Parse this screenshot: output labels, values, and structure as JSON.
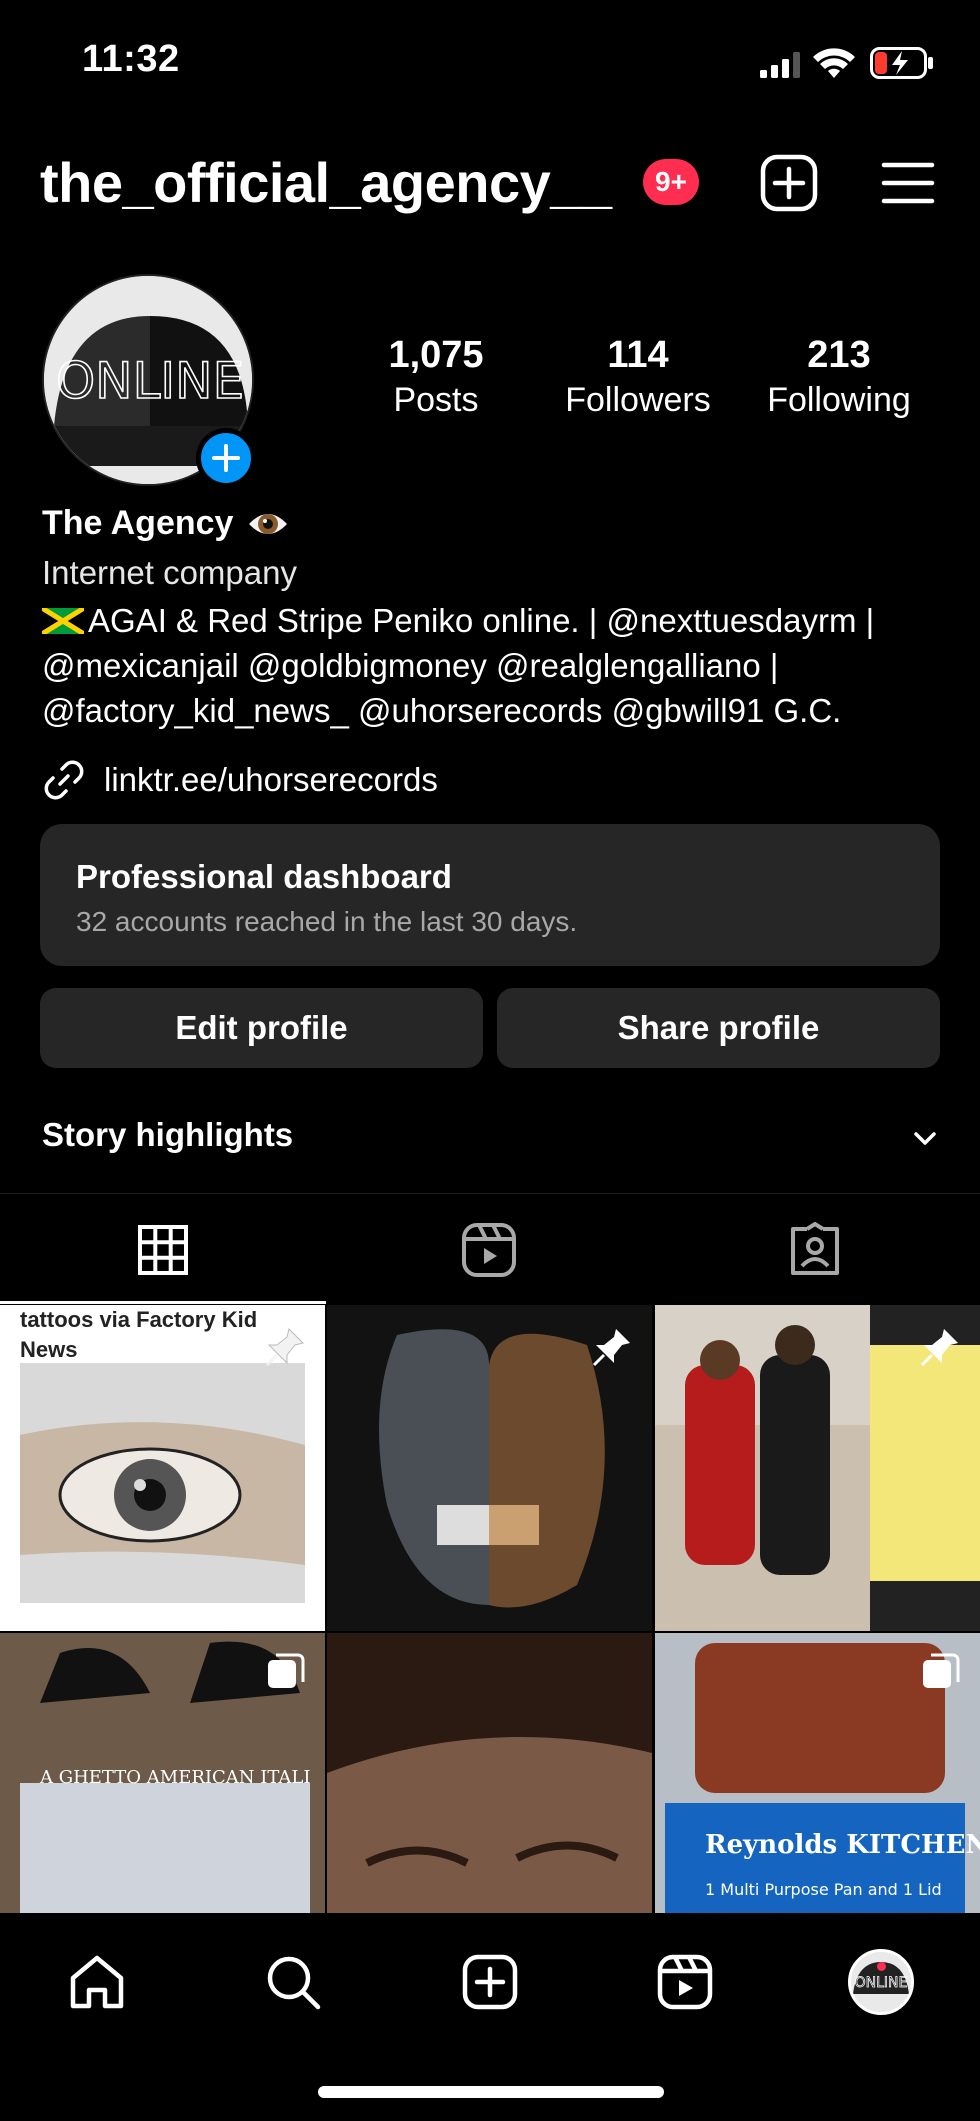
{
  "status_bar": {
    "time": "11:32",
    "icons": [
      "signal-icon",
      "wifi-icon",
      "battery-charging-icon"
    ]
  },
  "header": {
    "username": "the_official_agency__",
    "notifications": "9+",
    "icons": [
      "create-post-icon",
      "menu-icon"
    ]
  },
  "profile": {
    "avatar_text": "ONLINE",
    "stats": [
      {
        "value": "1,075",
        "label": "Posts"
      },
      {
        "value": "114",
        "label": "Followers"
      },
      {
        "value": "213",
        "label": "Following"
      }
    ],
    "display_name": "The Agency",
    "category": "Internet company",
    "bio_lines": [
      "AGAI & Red Stripe Peniko online. | @nexttuesdayrm |",
      "@mexicanjail @goldbigmoney @realglengalliano |",
      "@factory_kid_news_ @uhorserecords @gbwill91 G.C."
    ],
    "link": "linktr.ee/uhorserecords"
  },
  "dashboard": {
    "title": "Professional dashboard",
    "subtitle": "32 accounts reached in the last 30 days."
  },
  "buttons": {
    "edit": "Edit profile",
    "share": "Share profile"
  },
  "highlights": {
    "label": "Story highlights"
  },
  "tabs": [
    "grid-icon",
    "reels-icon",
    "tagged-icon"
  ],
  "grid": {
    "tile1_caption": "tattoos via Factory Kid News",
    "tile4_text": "A GHETTO AMERICAN ITALI",
    "tile6_text": "Reynolds KITCHENS",
    "tile6_sub": "1 Multi Purpose Pan and 1 Lid"
  },
  "colors": {
    "accent_blue": "#0095f6",
    "badge_red": "#ff2d4f",
    "card_bg": "#262626"
  }
}
